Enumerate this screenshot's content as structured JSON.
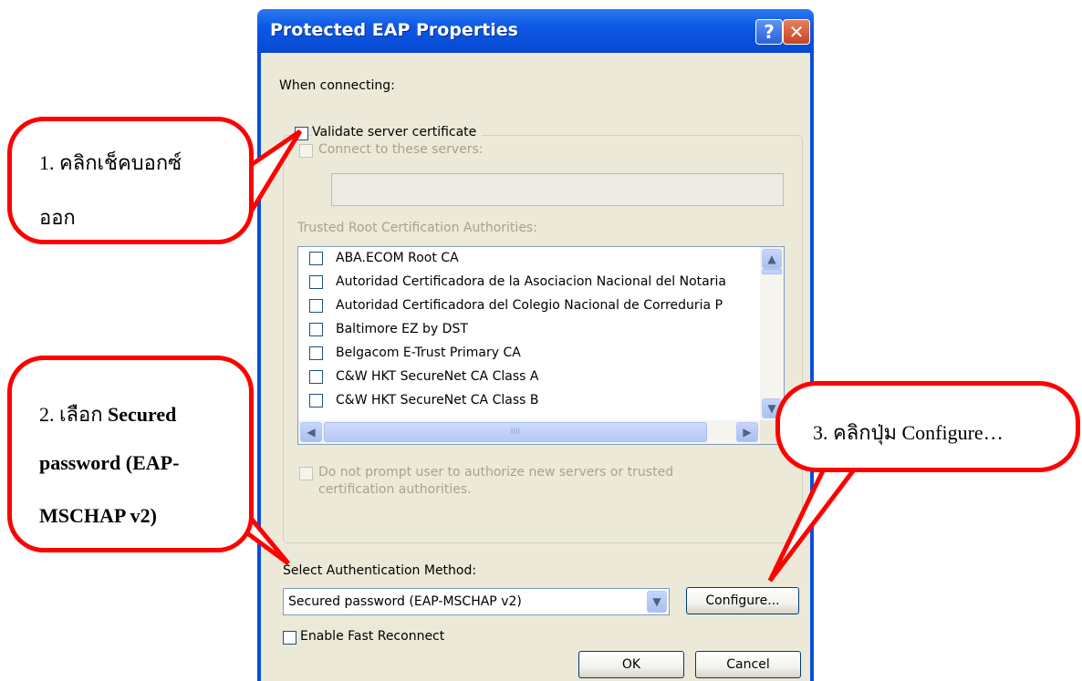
{
  "dialog": {
    "title": "Protected EAP Properties",
    "help_glyph": "?",
    "close_glyph": "✕",
    "when_connecting": "When connecting:",
    "validate_cert_label": "Validate server certificate",
    "connect_servers_label": "Connect to these servers:",
    "servers_value": "",
    "trusted_root_label": "Trusted Root Certification Authorities:",
    "cert_list": [
      "ABA.ECOM Root CA",
      "Autoridad Certificadora de la Asociacion Nacional del Notaria",
      "Autoridad Certificadora del Colegio Nacional de Correduria P",
      "Baltimore EZ by DST",
      "Belgacom E-Trust Primary CA",
      "C&W HKT SecureNet CA Class A",
      "C&W HKT SecureNet CA Class B"
    ],
    "scroll_up": "▲",
    "scroll_down": "▼",
    "scroll_left": "◀",
    "scroll_right": "▶",
    "scroll_grip": "IIII",
    "do_not_prompt_line1": "Do not prompt user to authorize new servers or trusted",
    "do_not_prompt_line2": "certification authorities.",
    "select_auth_label": "Select Authentication Method:",
    "auth_method_value": "Secured password (EAP-MSCHAP v2)",
    "dropdown_glyph": "▼",
    "configure_button": "Configure...",
    "fast_reconnect_label": "Enable Fast Reconnect",
    "ok_button": "OK",
    "cancel_button": "Cancel"
  },
  "callouts": {
    "step1_line1": "1. คลิกเช็คบอกซ์",
    "step1_line2": "ออก",
    "step2_prefix": "2. เลือก ",
    "step2_bold": "Secured",
    "step2_line2": "password (EAP-",
    "step2_line3": "MSCHAP v2)",
    "step3": "3. คลิกปุ่ม Configure…"
  },
  "colors": {
    "annotation_red": "#ff0000",
    "titlebar_blue": "#0a4fd8",
    "dialog_face": "#ece9d8"
  }
}
